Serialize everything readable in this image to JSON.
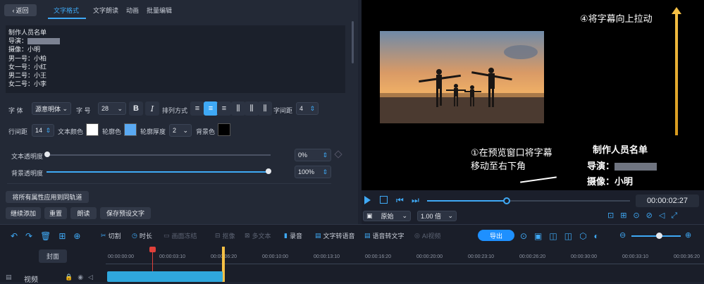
{
  "panel": {
    "back_label": "返回",
    "tabs": [
      "文字格式",
      "文字朗读",
      "动画",
      "批量编辑"
    ],
    "credits_lines": [
      "制作人员名单",
      "导演：",
      "摄像：小明",
      "男一号：小柏",
      "女一号：小红",
      "男二号：小王",
      "女二号：小李"
    ],
    "font_label": "字 体",
    "font_value": "源意明体",
    "size_label": "字 号",
    "size_value": "28",
    "align_label": "排列方式",
    "spacing_label": "字间距",
    "spacing_value": "4",
    "line_spacing_label": "行间距",
    "line_spacing_value": "14",
    "text_color_label": "文本颜色",
    "outline_color_label": "轮廓色",
    "outline_width_label": "轮廓厚度",
    "outline_width_value": "2",
    "bg_color_label": "背景色",
    "text_opacity_label": "文本透明度",
    "text_opacity_value": "0%",
    "text_opacity_level": 0,
    "bg_opacity_label": "背景透明度",
    "bg_opacity_value": "100%",
    "bg_opacity_level": 100,
    "apply_all_label": "将所有属性应用到同轨道",
    "continue_add_label": "继续添加",
    "reset_label": "重置",
    "read_label": "朗读",
    "save_preset_label": "保存预设文字",
    "colors": {
      "text": "#ffffff",
      "outline": "#5aa9f2",
      "background": "#000000",
      "accent": "#3fa9f5"
    }
  },
  "preview": {
    "annotation_top": "④将字幕向上拉动",
    "annotation_mid_line1": "①在预览窗口将字幕",
    "annotation_mid_line2": "移动至右下角",
    "subtitle_title": "制作人员名单",
    "subtitle_director": "导演：",
    "subtitle_camera": "摄像：小明",
    "time": "00:00:02:27",
    "ratio": "原始",
    "speed": "1.00 倍"
  },
  "toolbar": {
    "cut": "切割",
    "duration": "时长",
    "freeze": "画面冻结",
    "matting": "抠像",
    "multi_text": "多文本",
    "record": "录音",
    "tts": "文字转语音",
    "stt": "语音转文字",
    "ai": "AI视频",
    "export": "导出"
  },
  "timeline": {
    "cover_label": "封面",
    "video_label": "视频",
    "ticks": [
      "00:00:00:00",
      "00:00:03:10",
      "00:00:06:20",
      "00:00:10:00",
      "00:00:13:10",
      "00:00:16:20",
      "00:00:20:00",
      "00:00:23:10",
      "00:00:26:20",
      "00:00:30:00",
      "00:00:33:10",
      "00:00:36:20"
    ]
  }
}
